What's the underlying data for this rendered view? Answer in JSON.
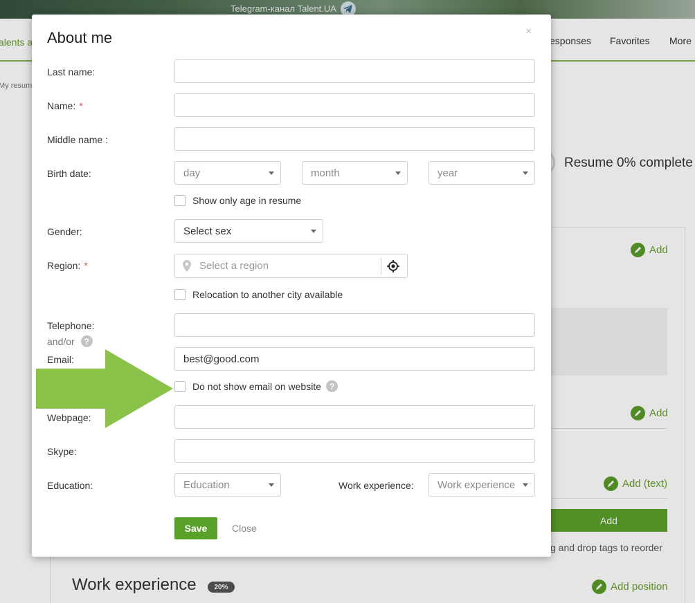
{
  "background": {
    "banner_text": "Telegram-канал Talent.UA",
    "nav_left": "alents a",
    "nav_items": [
      "esponses",
      "Favorites",
      "More"
    ],
    "breadcrumb": "My resume",
    "resume_complete": "Resume 0% complete",
    "add_label": "Add",
    "add_text_label": "Add (text)",
    "add_button": "Add",
    "drag_hint": "g and drop tags to reorder",
    "work_experience_heading": "Work experience",
    "work_experience_pct": "20%",
    "add_position_label": "Add position"
  },
  "modal": {
    "title": "About me",
    "close_symbol": "×",
    "fields": {
      "last_name": {
        "label": "Last name:",
        "value": ""
      },
      "name": {
        "label": "Name:",
        "required_mark": "*",
        "value": ""
      },
      "middle_name": {
        "label": "Middle name :",
        "value": ""
      },
      "birth_date": {
        "label": "Birth date:",
        "day": "day",
        "month": "month",
        "year": "year"
      },
      "show_age": {
        "label": "Show only age in resume",
        "checked": false
      },
      "gender": {
        "label": "Gender:",
        "value": "Select sex"
      },
      "region": {
        "label": "Region:",
        "required_mark": "*",
        "placeholder": "Select a region"
      },
      "relocation": {
        "label": "Relocation to another city available",
        "checked": false
      },
      "telephone": {
        "label": "Telephone:",
        "and_or": "and/or",
        "value": ""
      },
      "email": {
        "label": "Email:",
        "value": "best@good.com"
      },
      "hide_email": {
        "label": "Do not show email on website",
        "checked": false
      },
      "webpage": {
        "label": "Webpage:",
        "value": ""
      },
      "skype": {
        "label": "Skype:",
        "value": ""
      },
      "education": {
        "label": "Education:",
        "value": "Education"
      },
      "work_experience": {
        "label": "Work experience:",
        "value": "Work experience"
      }
    },
    "help_symbol": "?",
    "save_label": "Save",
    "close_label": "Close"
  },
  "colors": {
    "accent": "#5aa12a",
    "arrow": "#8bc34a",
    "required": "#d9534f"
  }
}
